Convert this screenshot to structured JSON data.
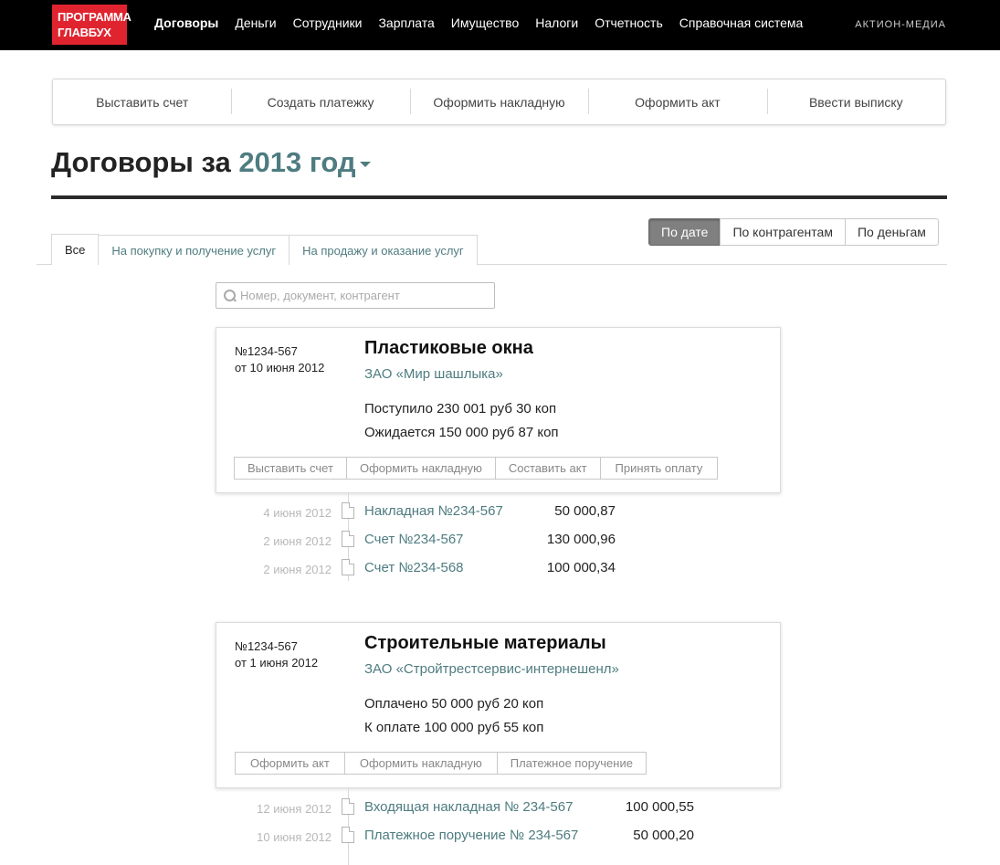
{
  "topbar": {
    "logo": {
      "line1": "ПРОГРАММА",
      "line2": "ГЛАВБУХ"
    },
    "nav": [
      "Договоры",
      "Деньги",
      "Сотрудники",
      "Зарплата",
      "Имущество",
      "Налоги",
      "Отчетность",
      "Справочная система"
    ],
    "brand": "АКТИОН-МЕДИА"
  },
  "actions": [
    "Выставить счет",
    "Создать платежку",
    "Оформить накладную",
    "Оформить акт",
    "Ввести выписку"
  ],
  "heading": {
    "prefix": "Договоры за",
    "year": "2013 год"
  },
  "tabs": [
    "Все",
    "На покупку и получение услуг",
    "На продажу и оказание услуг"
  ],
  "sort": [
    "По дате",
    "По контрагентам",
    "По деньгам"
  ],
  "search": {
    "placeholder": "Номер, документ, контрагент"
  },
  "contracts": [
    {
      "number": "№1234-567",
      "date": "от 10 июня 2012",
      "title": "Пластиковые окна",
      "company": "ЗАО «Мир шашлыка»",
      "line1": "Поступило 230 001 руб 30 коп",
      "line2": "Ожидается 150 000 руб 87 коп",
      "buttons": [
        "Выставить счет",
        "Оформить накладную",
        "Составить акт",
        "Принять оплату"
      ],
      "documents": [
        {
          "date": "4 июня 2012",
          "name": "Накладная №234-567",
          "amount": "50 000,87"
        },
        {
          "date": "2 июня 2012",
          "name": "Счет №234-567",
          "amount": "130 000,96"
        },
        {
          "date": "2 июня 2012",
          "name": "Счет №234-568",
          "amount": "100 000,34"
        }
      ]
    },
    {
      "number": "№1234-567",
      "date": "от 1 июня 2012",
      "title": "Строительные материалы",
      "company": "ЗАО «Стройтрестсервис-интернешенл»",
      "line1": "Оплачено 50 000 руб 20 коп",
      "line2": "К оплате 100 000 руб 55 коп",
      "buttons": [
        "Оформить акт",
        "Оформить накладную",
        "Платежное поручение"
      ],
      "documents": [
        {
          "date": "12 июня 2012",
          "name": "Входящая накладная № 234-567",
          "amount": "100 000,55"
        },
        {
          "date": "10 июня 2012",
          "name": "Платежное поручение № 234-567",
          "amount": "50 000,20"
        }
      ]
    }
  ]
}
